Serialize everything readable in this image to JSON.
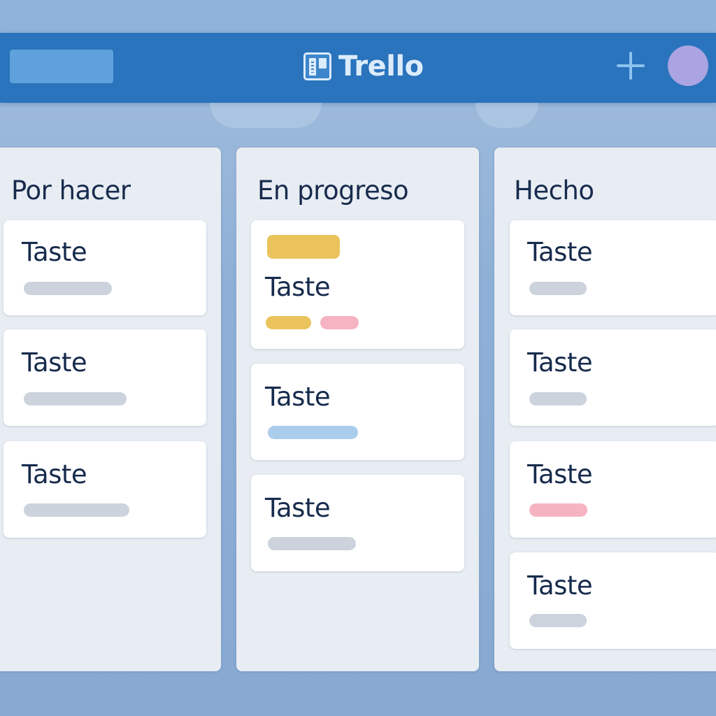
{
  "app": {
    "brand": "Trello",
    "colors": {
      "header": "#2a73bd",
      "column_bg": "#e8edf3",
      "card_bg": "#ffffff",
      "label_gray": "#ccd3dd",
      "label_blue": "#abcdec",
      "label_yellow": "#eac35c",
      "label_pink": "#f6b3c2",
      "avatar": "#aaa4e2"
    }
  },
  "header": {
    "logo_icon": "trello-board-icon",
    "add_icon": "plus-icon"
  },
  "lists": [
    {
      "title": "Por hacer",
      "cards": [
        {
          "title": "Taste",
          "labels": [
            "gray"
          ]
        },
        {
          "title": "Taste",
          "labels": [
            "gray"
          ]
        },
        {
          "title": "Taste",
          "labels": [
            "gray"
          ]
        }
      ]
    },
    {
      "title": "En progreso",
      "cards": [
        {
          "title": "Taste",
          "labels": [
            "yellow",
            "pink"
          ],
          "top_badge": "yellow"
        },
        {
          "title": "Taste",
          "labels": [
            "blue"
          ]
        },
        {
          "title": "Taste",
          "labels": [
            "gray"
          ]
        }
      ]
    },
    {
      "title": "Hecho",
      "cards": [
        {
          "title": "Taste",
          "labels": [
            "gray"
          ]
        },
        {
          "title": "Taste",
          "labels": [
            "gray"
          ]
        },
        {
          "title": "Taste",
          "labels": [
            "pink"
          ]
        },
        {
          "title": "Taste",
          "labels": [
            "gray"
          ]
        }
      ]
    }
  ]
}
